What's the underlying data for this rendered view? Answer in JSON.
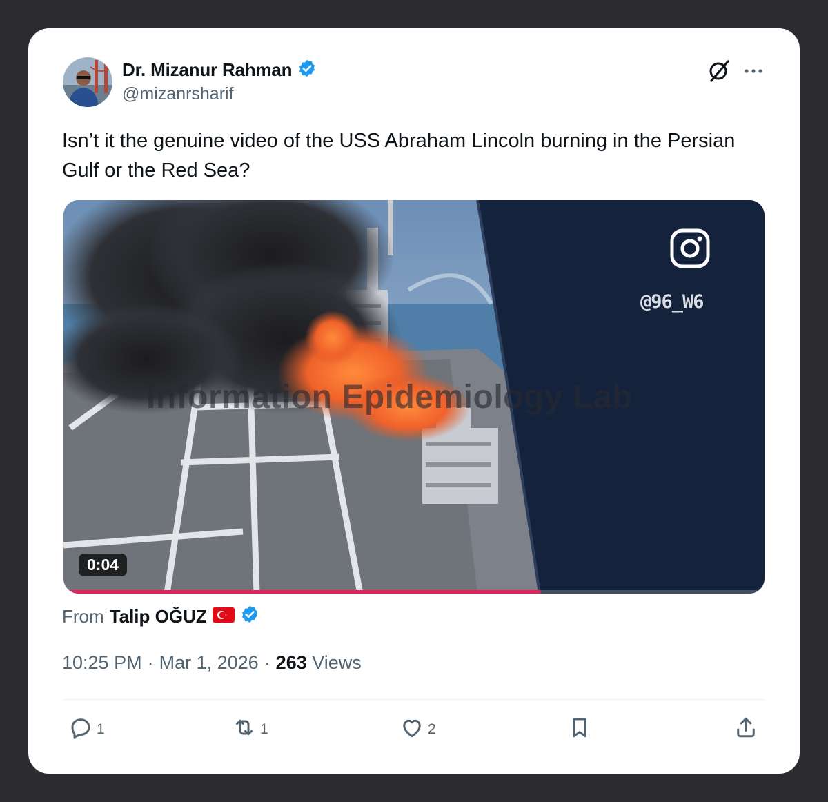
{
  "author": {
    "display_name": "Dr. Mizanur Rahman",
    "handle": "@mizanrsharif",
    "verified": true
  },
  "header_icons": [
    "grok-icon",
    "more-icon"
  ],
  "tweet": {
    "text": "Isn’t it the genuine video of the USS Abraham Lincoln burning in the Persian Gulf or the Red Sea?"
  },
  "media": {
    "type": "video",
    "duration": "0:04",
    "progress_fraction": 0.68,
    "overlay_handle": "@96_W6",
    "watermark": "Information Epidemiology Lab",
    "overlay_icon": "instagram-icon"
  },
  "source": {
    "from_label": "From",
    "name": "Talip OĞUZ",
    "flag": "turkey-flag-icon",
    "verified": true
  },
  "meta": {
    "time": "10:25 PM",
    "separator": "·",
    "date": "Mar 1, 2026",
    "views_count": "263",
    "views_label": "Views"
  },
  "actions": {
    "replies": "1",
    "reposts": "1",
    "likes": "2"
  },
  "colors": {
    "accent": "#1d9bf0",
    "text": "#0f1419",
    "muted": "#536471",
    "progress": "#e0245e",
    "page_bg": "#2c2c30"
  }
}
